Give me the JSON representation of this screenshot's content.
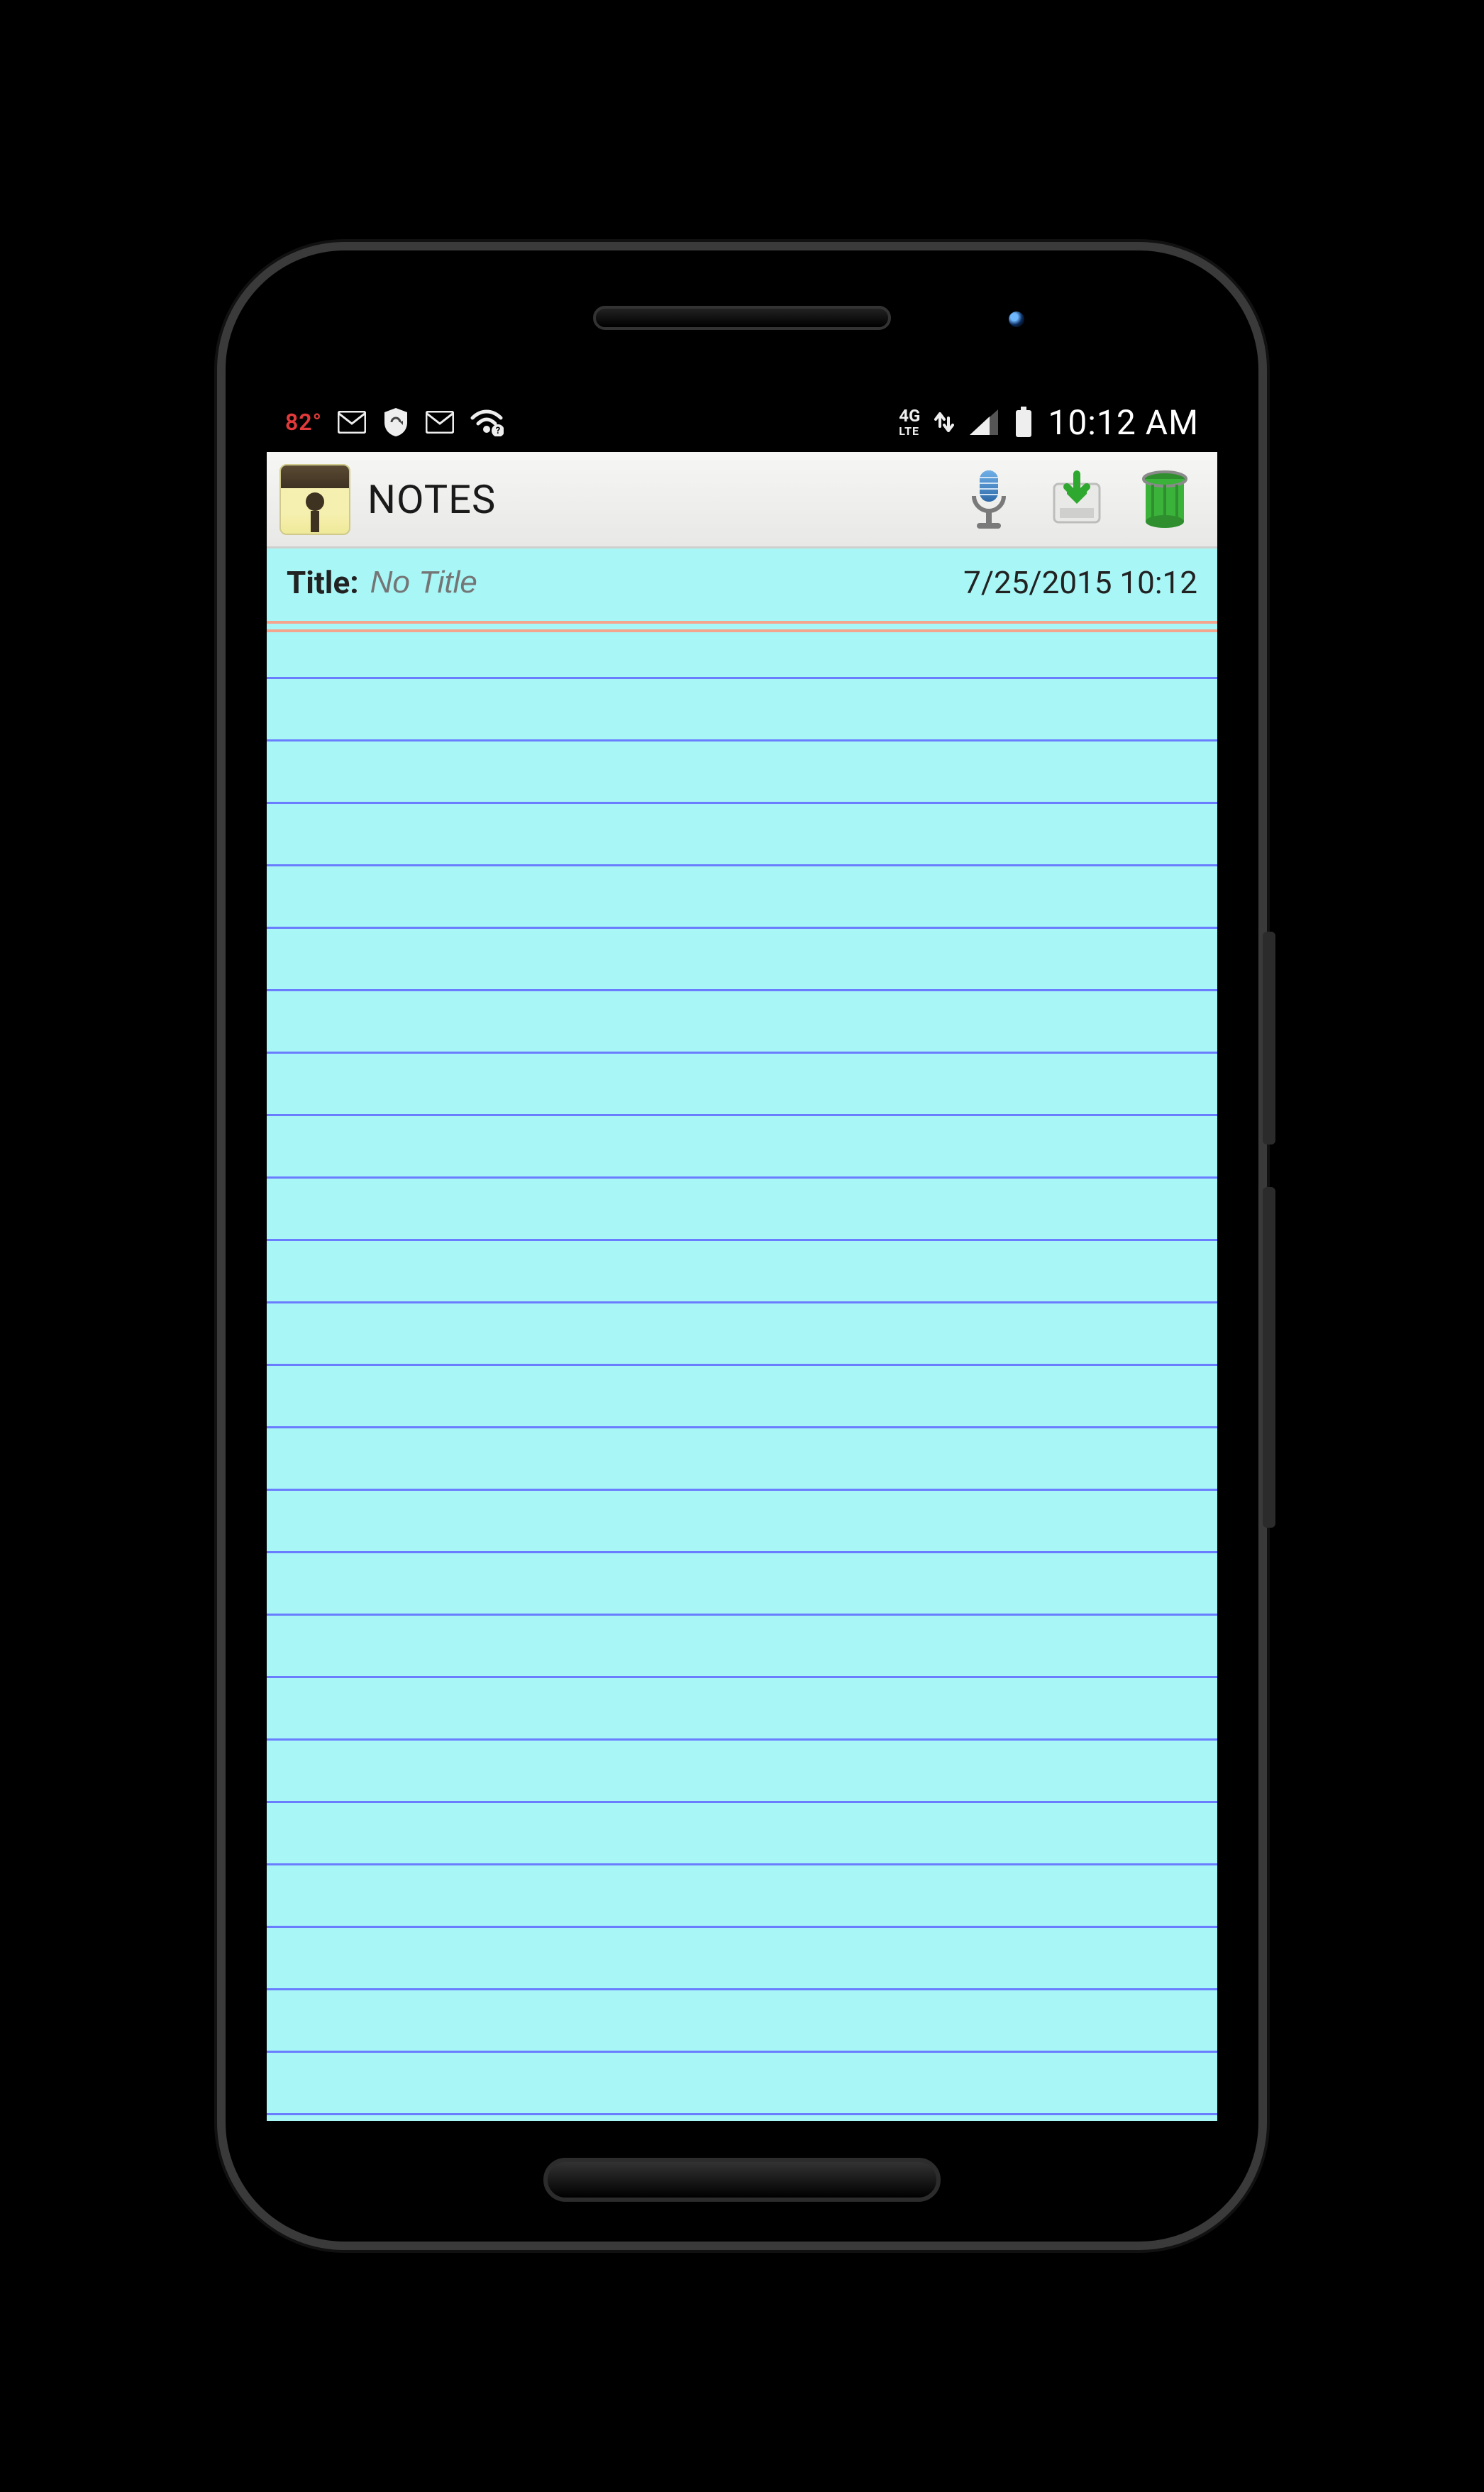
{
  "status": {
    "temperature": "82°",
    "network_label": "4G",
    "network_sub": "LTE",
    "clock": "10:12 AM"
  },
  "appbar": {
    "title": "NOTES"
  },
  "title_row": {
    "label": "Title:",
    "placeholder": "No Title",
    "value": "",
    "datetime": "7/25/2015 10:12"
  },
  "note": {
    "body": ""
  },
  "colors": {
    "paper": "#a8f6f6",
    "rule": "#6a7dff",
    "top_rule": "#f4a58e",
    "appbar_bg_top": "#f6f6f4",
    "appbar_bg_bottom": "#e8e8e6"
  }
}
